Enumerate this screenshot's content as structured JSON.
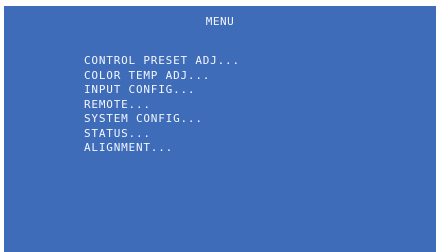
{
  "osd": {
    "title": "MENU",
    "items": [
      {
        "label": "CONTROL PRESET ADJ..."
      },
      {
        "label": "COLOR TEMP ADJ..."
      },
      {
        "label": "INPUT CONFIG..."
      },
      {
        "label": "REMOTE..."
      },
      {
        "label": "SYSTEM CONFIG..."
      },
      {
        "label": "STATUS..."
      },
      {
        "label": "ALIGNMENT..."
      }
    ],
    "colors": {
      "background": "#3f6cb8",
      "text": "#f2f6ff"
    }
  }
}
